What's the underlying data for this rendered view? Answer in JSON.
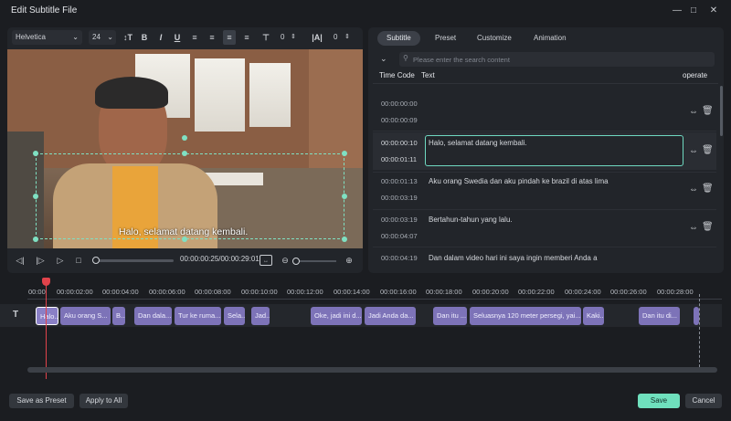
{
  "window": {
    "title": "Edit Subtitle File",
    "controls": [
      "minimize-icon",
      "maximize-icon",
      "close-icon"
    ]
  },
  "format_toolbar": {
    "font": "Helvetica",
    "size": "24",
    "line_spacing": "0",
    "char_spacing": "0",
    "buttons": [
      "B",
      "I",
      "U"
    ]
  },
  "preview": {
    "caption": "Halo, selamat datang kembali.",
    "timecode": "00:00:00:25/00:00:29:01",
    "progress_fraction": 0.02
  },
  "tabs": [
    {
      "label": "Subtitle",
      "active": true
    },
    {
      "label": "Preset",
      "active": false
    },
    {
      "label": "Customize",
      "active": false
    },
    {
      "label": "Animation",
      "active": false
    }
  ],
  "search": {
    "placeholder": "Please enter the search content"
  },
  "list_headers": {
    "time": "Time Code",
    "text": "Text",
    "operate": "operate"
  },
  "subtitles": [
    {
      "start": "00:00:00:00",
      "end": "00:00:00:09",
      "text": ""
    },
    {
      "start": "00:00:00:10",
      "end": "00:00:01:11",
      "text": "Halo, selamat datang kembali."
    },
    {
      "start": "00:00:01:13",
      "end": "00:00:03:19",
      "text": "Aku orang Swedia dan aku pindah ke brazil di atas lima"
    },
    {
      "start": "00:00:03:19",
      "end": "00:00:04:07",
      "text": "Bertahun-tahun yang lalu."
    },
    {
      "start": "00:00:04:19",
      "end": "",
      "text": "Dan dalam video hari ini saya ingin memberi Anda a"
    }
  ],
  "timeline": {
    "ruler": [
      "00:00",
      "00:00:02:00",
      "00:00:04:00",
      "00:00:06:00",
      "00:00:08:00",
      "00:00:10:00",
      "00:00:12:00",
      "00:00:14:00",
      "00:00:16:00",
      "00:00:18:00",
      "00:00:20:00",
      "00:00:22:00",
      "00:00:24:00",
      "00:00:26:00",
      "00:00:28:00"
    ],
    "clips": [
      "Halo...",
      "Aku orang S...",
      "B...",
      "Dan dala...",
      "Tur ke ruma...",
      "Sela...",
      "Jad...",
      "Oke, jadi ini d...",
      "Jadi Anda da...",
      "Dan itu ...",
      "Seluasnya 120 meter persegi, yai...",
      "Kaki...",
      "Dan itu di..."
    ]
  },
  "footer": {
    "save_preset": "Save as Preset",
    "apply_all": "Apply to All",
    "save": "Save",
    "cancel": "Cancel"
  },
  "colors": {
    "accent": "#6fe0bd",
    "clip": "#7d73b8",
    "playhead": "#e2434b"
  }
}
